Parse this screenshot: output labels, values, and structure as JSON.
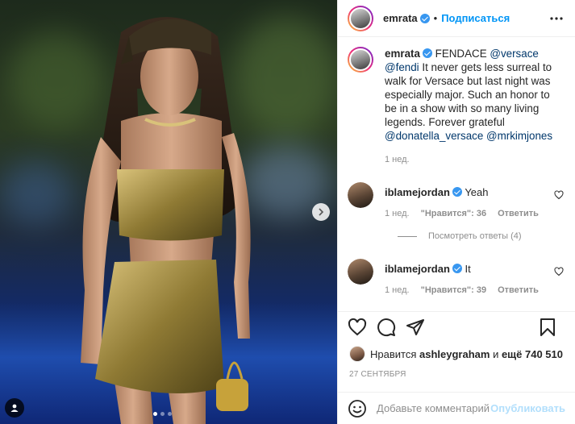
{
  "post": {
    "author": "emrata",
    "follow_label": "Подписаться",
    "separator": "•"
  },
  "caption": {
    "author": "emrata",
    "text_1": " FENDACE ",
    "mention_1": "@versace",
    "text_2": " ",
    "mention_2": "@fendi",
    "text_3": " It never gets less surreal to walk for Versace but last night was especially major. Such an honor to be in a show with so many living legends. Forever grateful ",
    "mention_3": "@donatella_versace",
    "text_4": " ",
    "mention_4": "@mrkimjones",
    "time": "1 нед."
  },
  "comments": [
    {
      "author": "iblamejordan",
      "text": "Yeah",
      "time": "1 нед.",
      "likes": "\"Нравится\": 36",
      "reply": "Ответить"
    },
    {
      "author": "iblamejordan",
      "text": "It",
      "time": "1 нед.",
      "likes": "\"Нравится\": 39",
      "reply": "Ответить"
    }
  ],
  "view_replies": "Посмотреть ответы (4)",
  "likes": {
    "prefix": "Нравится",
    "user": "ashleygraham",
    "conj": "и",
    "others": "ещё 740 510"
  },
  "date": "27 сентября",
  "add_comment": {
    "placeholder": "Добавьте комментарий...",
    "publish": "Опубликовать"
  },
  "carousel": {
    "slides": 3,
    "active": 0
  },
  "colors": {
    "accent": "#0095f6",
    "verified": "#3897f0",
    "publish_disabled": "#b2dffc"
  },
  "icons": [
    "more-icon",
    "heart-icon",
    "comment-icon",
    "share-icon",
    "bookmark-icon",
    "emoji-icon",
    "user-tag-icon",
    "chevron-right-icon",
    "verified-icon"
  ]
}
